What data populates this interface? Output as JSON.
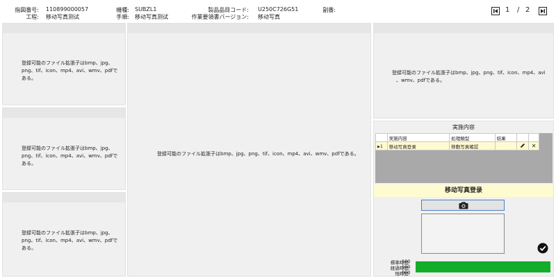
{
  "header": {
    "fields": [
      {
        "label": "指図番号:",
        "value": "110899000057"
      },
      {
        "label": "工程:",
        "value": "移动写真测试"
      },
      {
        "label": "機種:",
        "value": "SUBZL1"
      },
      {
        "label": "手順:",
        "value": "移动写真测试"
      },
      {
        "label": "製品品目コード:",
        "value": "U250C726G51"
      },
      {
        "label": "作業要領書バージョン:",
        "value": "移动写真"
      },
      {
        "label": "副番:",
        "value": ""
      }
    ],
    "pager": {
      "current": "1",
      "separator": "/",
      "total": "2"
    }
  },
  "panels": {
    "msg_wrapped": [
      "登録可能のファイル拡張子はbmp、jpg、",
      "png、tif、icon、mp4、avi、wmv、pdfで",
      "ある。"
    ],
    "msg_center": "登録可能のファイル拡張子はbmp、jpg、png、tif、icon、mp4、avi、wmv、pdfである。",
    "msg_right": [
      "登録可能のファイル拡張子はbmp、jpg、png、tif、icon、mp4、avi",
      "、wmv、pdfである。"
    ]
  },
  "work": {
    "title": "実施内容",
    "columns": [
      "実施内容",
      "処理類型",
      "結果"
    ],
    "rows": [
      {
        "no": "1",
        "content": "移动写真登录",
        "type": "移動写真確認",
        "result": ""
      }
    ],
    "current_step": "移动写真登录"
  },
  "icons": {
    "first": "first-page-icon",
    "last": "last-page-icon",
    "camera": "camera-icon",
    "edit": "pencil-icon",
    "delete": "close-icon",
    "confirm": "check-circle-icon"
  },
  "timers": [
    {
      "label": "標準時間:",
      "value": "100"
    },
    {
      "label": "経過時間:",
      "value": "100"
    },
    {
      "label": "残時間:",
      "value": "000"
    }
  ],
  "progress": {
    "fraction": 1.0,
    "color": "#13ad2a"
  },
  "colors": {
    "highlight": "#fffbd0",
    "panel": "#f0f0f0",
    "camera_border": "#4a7fbf"
  }
}
